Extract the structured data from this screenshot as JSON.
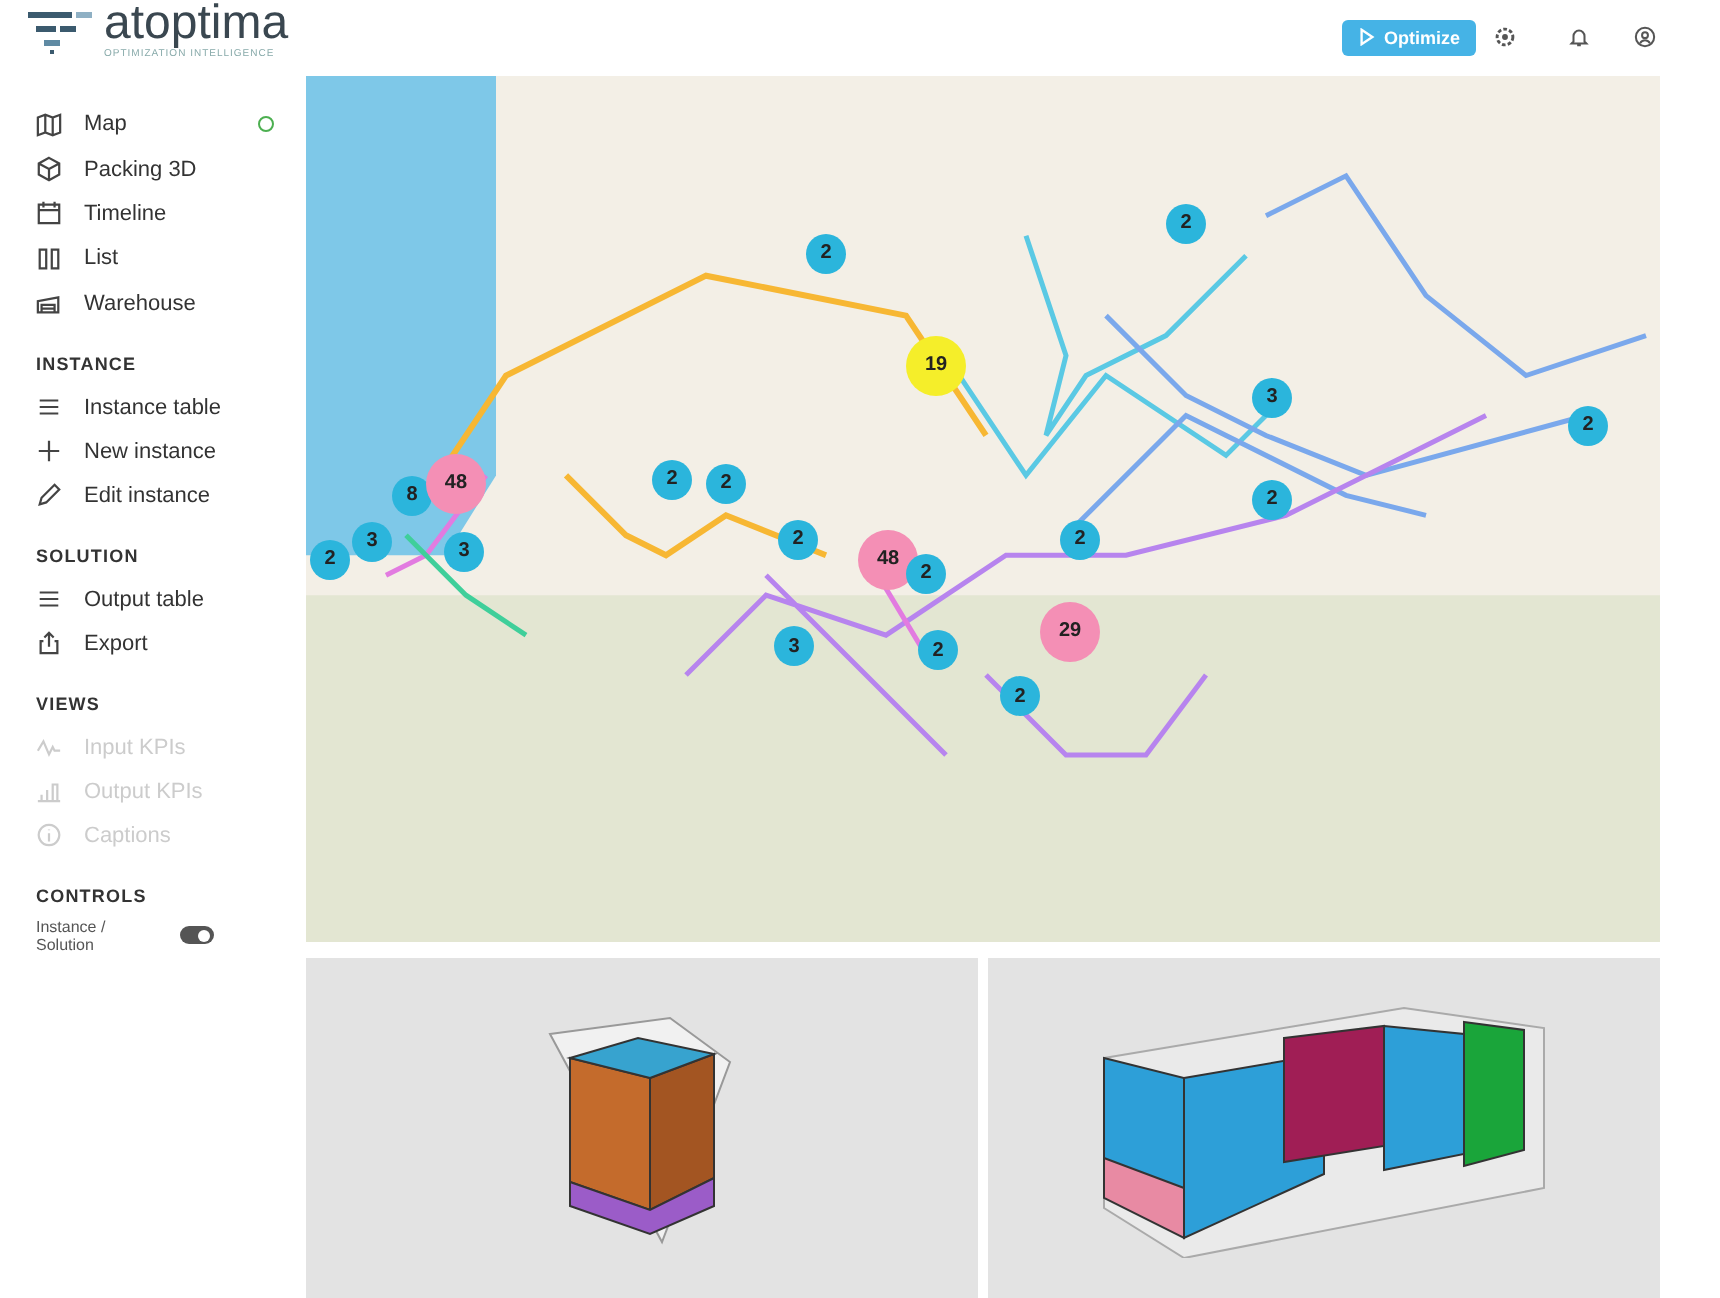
{
  "logo": {
    "name": "atoptima",
    "tagline": "OPTIMIZATION INTELLIGENCE"
  },
  "header": {
    "optimize_button": "Optimize"
  },
  "nav": [
    {
      "label": "Map",
      "kind": "map",
      "selected": true
    },
    {
      "label": "Packing 3D",
      "kind": "cube",
      "selected": false
    },
    {
      "label": "Timeline",
      "kind": "calendar",
      "selected": false
    },
    {
      "label": "List",
      "kind": "columns",
      "selected": false
    },
    {
      "label": "Warehouse",
      "kind": "warehouse",
      "selected": false
    }
  ],
  "sections": [
    {
      "title": "INSTANCE",
      "items": [
        {
          "label": "Instance table",
          "kind": "lines",
          "disabled": false
        },
        {
          "label": "New instance",
          "kind": "plus",
          "disabled": false
        },
        {
          "label": "Edit instance",
          "kind": "pencil",
          "disabled": false
        }
      ]
    },
    {
      "title": "SOLUTION",
      "items": [
        {
          "label": "Output table",
          "kind": "lines",
          "disabled": false
        },
        {
          "label": "Export",
          "kind": "share",
          "disabled": false
        }
      ]
    },
    {
      "title": "VIEWS",
      "items": [
        {
          "label": "Input KPIs",
          "kind": "pulse",
          "disabled": true
        },
        {
          "label": "Output KPIs",
          "kind": "bars",
          "disabled": true
        },
        {
          "label": "Captions",
          "kind": "info",
          "disabled": true
        }
      ]
    }
  ],
  "controls": {
    "title": "CONTROLS",
    "toggle_label": "Instance / Solution",
    "on": true
  },
  "map": {
    "clusters": [
      {
        "count": "2",
        "color": "#2bb5dc"
      },
      {
        "count": "2",
        "color": "#2bb5dc"
      },
      {
        "count": "19",
        "color": "#f5ee2a"
      },
      {
        "count": "3",
        "color": "#2bb5dc"
      },
      {
        "count": "2",
        "color": "#2bb5dc"
      },
      {
        "count": "2",
        "color": "#2bb5dc"
      },
      {
        "count": "2",
        "color": "#2bb5dc"
      },
      {
        "count": "8",
        "color": "#2bb5dc"
      },
      {
        "count": "48",
        "color": "#f48fb5"
      },
      {
        "count": "2",
        "color": "#2bb5dc"
      },
      {
        "count": "3",
        "color": "#2bb5dc"
      },
      {
        "count": "2",
        "color": "#2bb5dc"
      },
      {
        "count": "3",
        "color": "#2bb5dc"
      },
      {
        "count": "2",
        "color": "#2bb5dc"
      },
      {
        "count": "48",
        "color": "#f48fb5"
      },
      {
        "count": "2",
        "color": "#2bb5dc"
      },
      {
        "count": "2",
        "color": "#2bb5dc"
      },
      {
        "count": "29",
        "color": "#f48fb5"
      },
      {
        "count": "3",
        "color": "#2bb5dc"
      },
      {
        "count": "2",
        "color": "#2bb5dc"
      },
      {
        "count": "2",
        "color": "#2bb5dc"
      }
    ]
  }
}
